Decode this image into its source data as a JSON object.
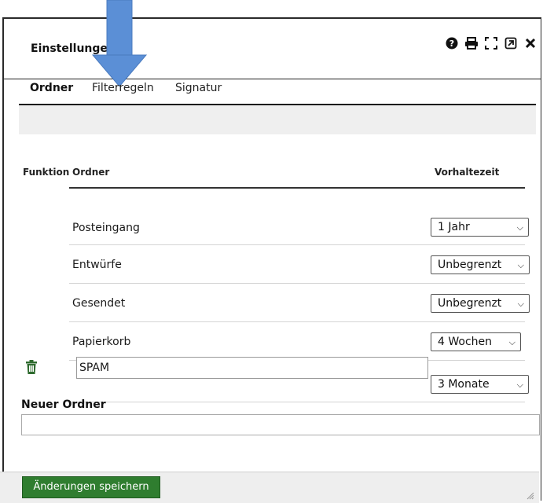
{
  "dialog": {
    "title": "Einstellungen",
    "toolbar_icons": [
      "help-icon",
      "print-icon",
      "fullscreen-icon",
      "popout-icon",
      "close-icon"
    ]
  },
  "tabs": [
    {
      "label": "Ordner",
      "active": true
    },
    {
      "label": "Filterregeln",
      "active": false
    },
    {
      "label": "Signatur",
      "active": false
    }
  ],
  "table": {
    "headers": {
      "funktion": "Funktion",
      "ordner": "Ordner",
      "vorhaltezeit": "Vorhaltezeit"
    },
    "rows": [
      {
        "name": "Posteingang",
        "retention": "1 Jahr",
        "deletable": false
      },
      {
        "name": "Entwürfe",
        "retention": "Unbegrenzt",
        "deletable": false
      },
      {
        "name": "Gesendet",
        "retention": "Unbegrenzt",
        "deletable": false
      },
      {
        "name": "Papierkorb",
        "retention": "4 Wochen",
        "deletable": false
      },
      {
        "name": "SPAM",
        "retention": "3 Monate",
        "deletable": true,
        "editable": true
      }
    ]
  },
  "new_folder": {
    "label": "Neuer Ordner",
    "value": ""
  },
  "footer": {
    "save_label": "Änderungen speichern"
  },
  "colors": {
    "accent_green": "#2f7d2f",
    "arrow_blue": "#5b8fd6"
  }
}
